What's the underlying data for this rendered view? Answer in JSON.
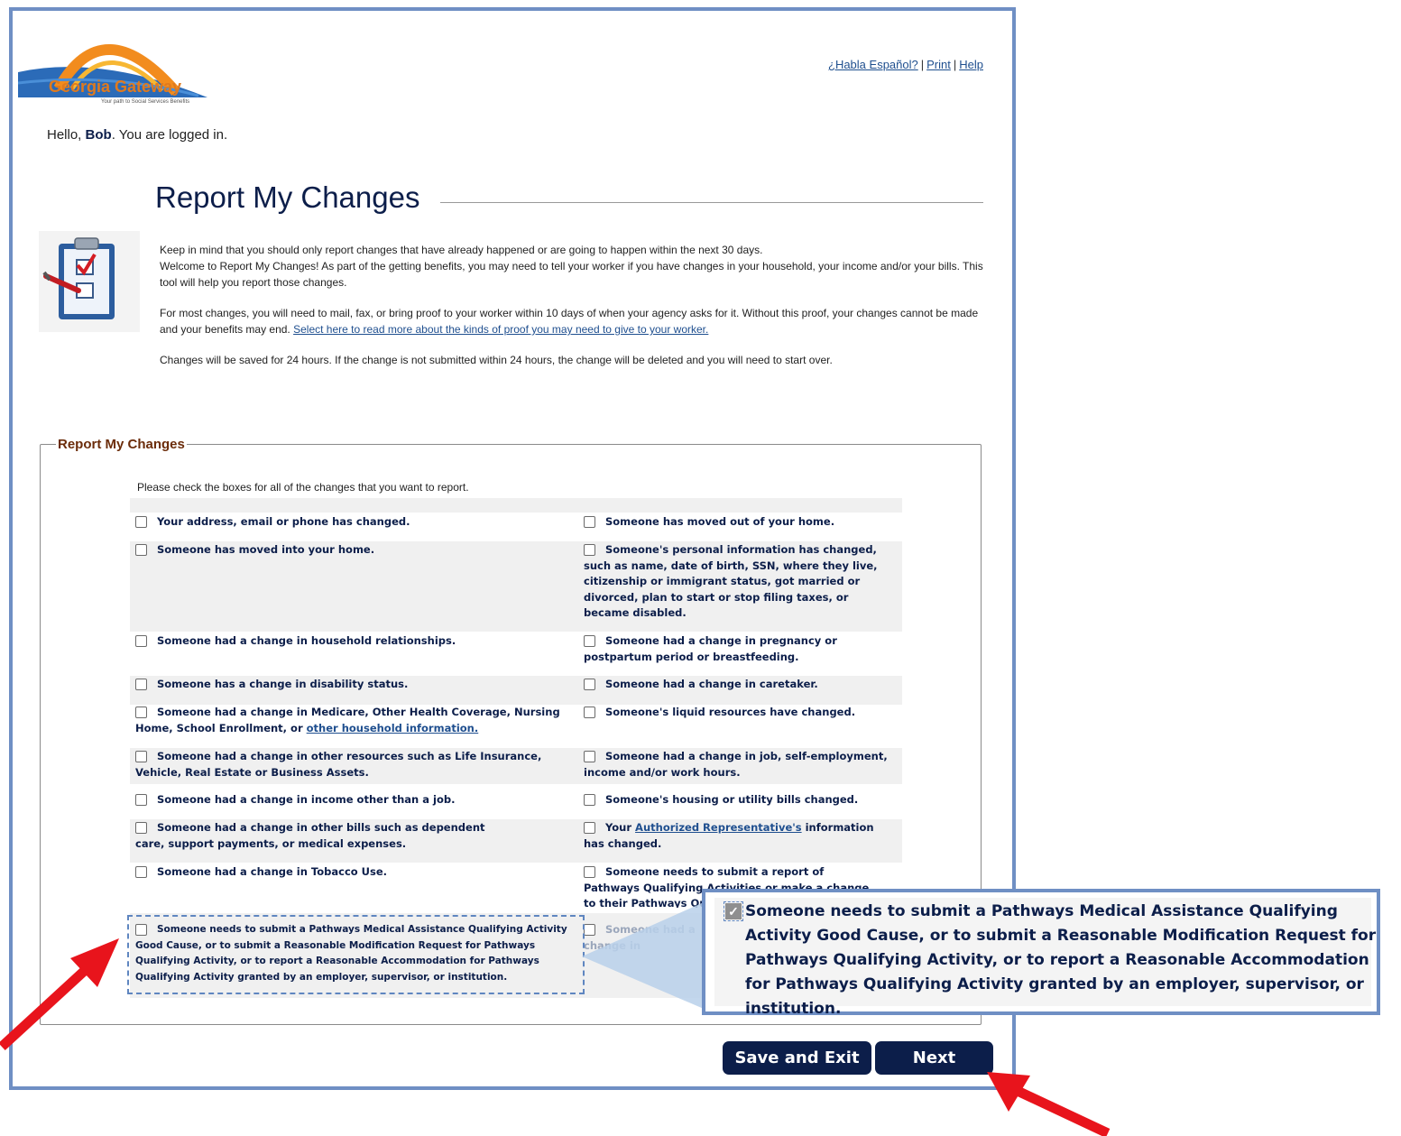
{
  "header": {
    "logo_text": "Georgia Gateway",
    "logo_tagline": "Your path to Social Services Benefits",
    "links": {
      "espanol": "¿Habla Español?",
      "print": "Print",
      "help": "Help",
      "sep": "|"
    },
    "greeting_prefix": "Hello, ",
    "user_name": "Bob",
    "greeting_suffix": ". You are logged in."
  },
  "page": {
    "title": "Report My Changes",
    "intro_line1": "Keep in mind that you should only report changes that have already happened or are going to happen within the next 30 days.",
    "intro_line2": "Welcome to Report My Changes! As part of the getting benefits, you may need to tell your worker if you have changes in your household, your income and/or your bills. This tool will help you report those changes.",
    "intro_proof": "For most changes, you will need to mail, fax, or bring proof to your worker within 10 days of when your agency asks for it. Without this proof, your changes cannot be made and your benefits may end. ",
    "intro_proof_link": "Select here to read more about the kinds of proof you may need to give to your worker.",
    "intro_saved": "Changes will be saved for 24 hours. If the change is not submitted within 24 hours, the change will be deleted and you will need to start over."
  },
  "form": {
    "legend": "Report My Changes",
    "instructions": "Please check the boxes for all of the changes that you want to report.",
    "options": {
      "address": "Your address, email or phone has changed.",
      "moved_out": "Someone has moved out of your home.",
      "moved_in": "Someone has moved into your home.",
      "personal_info": "Someone's personal information has changed, such as name, date of birth, SSN, where they live, citizenship or immigrant status, got married or divorced, plan to start or stop filing taxes, or became disabled.",
      "relationships": "Someone had a change in household relationships.",
      "pregnancy": "Someone had a change in pregnancy or postpartum period or breastfeeding.",
      "disability": "Someone has a change in disability status.",
      "caretaker": "Someone had a change in caretaker.",
      "medicare": "Someone had a change in Medicare, Other Health Coverage, Nursing Home, School Enrollment, or ",
      "medicare_link": "other household information.",
      "liquid": "Someone's liquid resources have changed.",
      "other_resources": "Someone had a change in other resources such as Life Insurance, Vehicle, Real Estate or Business Assets.",
      "job": "Someone had a change in job, self-employment, income and/or work hours.",
      "income_other": "Someone had a change in income other than a job.",
      "housing": "Someone's housing or utility bills changed.",
      "other_bills": "Someone had a change in other bills such as dependent care, support payments, or medical expenses.",
      "auth_rep_prefix": "Your ",
      "auth_rep_link": "Authorized Representative's",
      "auth_rep_suffix": " information has changed.",
      "tobacco": "Someone had a change in Tobacco Use.",
      "pathways_report": "Someone needs to submit a report of Pathways Qualifying Activities or make a change to their Pathways Qualifying Activities.",
      "pathways_good_cause": "Someone needs to submit a Pathways Medical Assistance Qualifying Activity Good Cause, or to submit a Reasonable Modification Request for Pathways Qualifying Activity, or to report a Reasonable Accommodation for Pathways Qualifying Activity granted by an employer, supervisor, or institution.",
      "vocational_rehab": "Someone had a change in Vocational Rehabilitation Agency"
    }
  },
  "callout": {
    "text": "Someone needs to submit a Pathways Medical Assistance Qualifying Activity Good Cause, or to submit a Reasonable Modification Request for Pathways Qualifying Activity, or to report a Reasonable Accommodation for Pathways Qualifying Activity granted by an employer, supervisor, or institution.",
    "checked": true
  },
  "buttons": {
    "save_exit": "Save and Exit",
    "next": "Next"
  },
  "colors": {
    "navy": "#0c1e4a",
    "frame_blue": "#6f8fc4",
    "legend_brown": "#6b2c0a",
    "arrow_red": "#e8141c",
    "logo_orange": "#e07a1e"
  }
}
